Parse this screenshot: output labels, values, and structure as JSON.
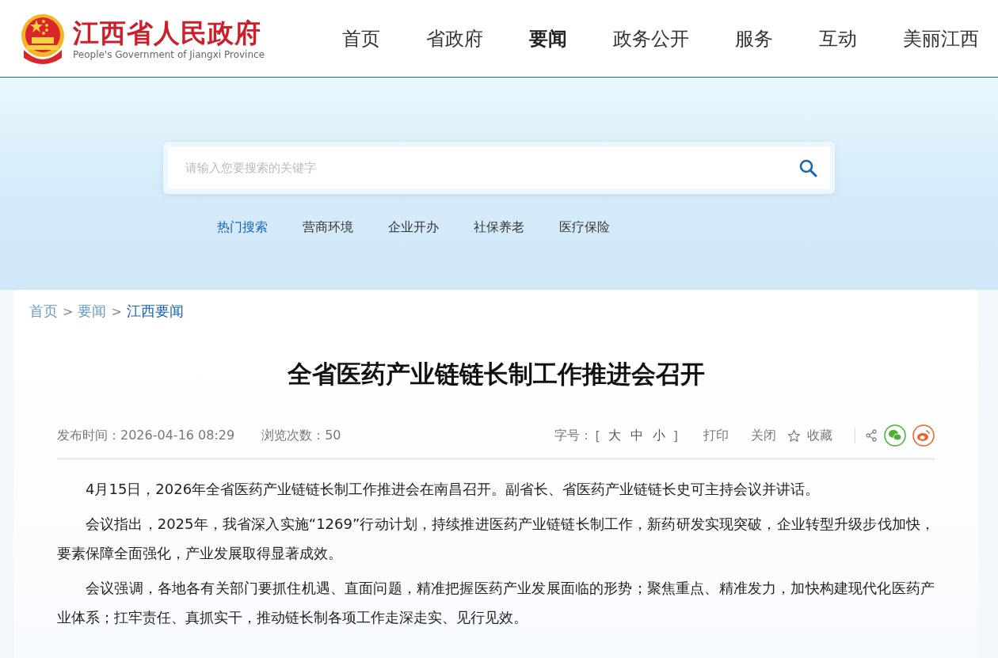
{
  "header": {
    "site_name": "江西省人民政府",
    "site_name_en": "People's Government of Jiangxi Province",
    "nav": [
      {
        "label": "首页",
        "selected": false
      },
      {
        "label": "省政府",
        "selected": false
      },
      {
        "label": "要闻",
        "selected": true
      },
      {
        "label": "政务公开",
        "selected": false
      },
      {
        "label": "服务",
        "selected": false
      },
      {
        "label": "互动",
        "selected": false
      },
      {
        "label": "美丽江西",
        "selected": false
      }
    ]
  },
  "search": {
    "placeholder": "请输入您要搜索的关键字",
    "hot_label": "热门搜索",
    "hot_terms": [
      "营商环境",
      "企业开办",
      "社保养老",
      "医疗保险"
    ]
  },
  "breadcrumb": {
    "separator": ">",
    "items": [
      {
        "label": "首页",
        "selected": false
      },
      {
        "label": "要闻",
        "selected": false
      },
      {
        "label": "江西要闻",
        "selected": true
      }
    ]
  },
  "article": {
    "title": "全省医药产业链链长制工作推进会召开",
    "published": "发布时间：2026-04-16 08:29",
    "views": "浏览次数：50",
    "font_size": {
      "label": "字号：",
      "open": "[",
      "options": [
        "大",
        "中",
        "小"
      ],
      "close": "]"
    },
    "actions": [
      "打印",
      "关闭"
    ],
    "favorite": "收藏",
    "paragraphs": [
      "4月15日，2026年全省医药产业链链长制工作推进会在南昌召开。副省长、省医药产业链链长史可主持会议并讲话。",
      "会议指出，2025年，我省深入实施“1269”行动计划，持续推进医药产业链链长制工作，新药研发实现突破，企业转型升级步伐加快，要素保障全面强化，产业发展取得显著成效。",
      "会议强调，各地各有关部门要抓住机遇、直面问题，精准把握医药产业发展面临的形势；聚焦重点、精准发力，加快构建现代化医药产业体系；扛牢责任、真抓实干，推动链长制各项工作走深走实、见行见效。"
    ]
  }
}
